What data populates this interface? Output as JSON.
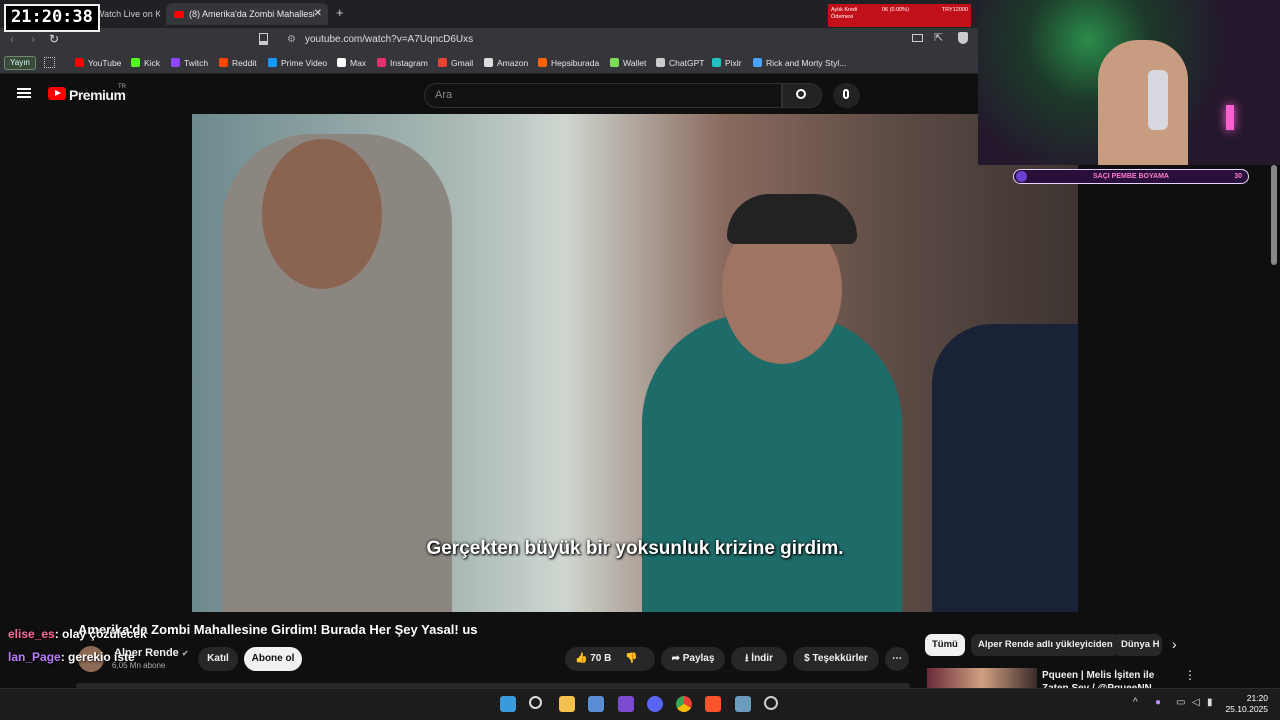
{
  "overlay": {
    "clock": "21:20:38",
    "widget_line1": "Aylık Kredi Ödemesi",
    "widget_line2": "06 (0.00%)",
    "widget_line3": "TRY12000",
    "progress_label": "SAÇI PEMBE BOYAMA",
    "progress_value": "30"
  },
  "tabs": [
    {
      "label": "Watch Live on Ki..."
    },
    {
      "label": "(8) Amerika'da Zombi Mahallesi"
    }
  ],
  "address": {
    "url": "youtube.com/watch?v=A7UqncD6Uxs"
  },
  "bookmarks": {
    "app_label": "Yayın",
    "items": [
      {
        "label": "YouTube",
        "color": "#ff0000"
      },
      {
        "label": "Kick",
        "color": "#53fc18"
      },
      {
        "label": "Twitch",
        "color": "#9146ff"
      },
      {
        "label": "Reddit",
        "color": "#ff4500"
      },
      {
        "label": "Prime Video",
        "color": "#1399ff"
      },
      {
        "label": "Max",
        "color": "#ffffff"
      },
      {
        "label": "Instagram",
        "color": "#e1306c"
      },
      {
        "label": "Gmail",
        "color": "#ea4335"
      },
      {
        "label": "Amazon",
        "color": "#dddddd"
      },
      {
        "label": "Hepsiburada",
        "color": "#ff6000"
      },
      {
        "label": "Wallet",
        "color": "#7ed957"
      },
      {
        "label": "ChatGPT",
        "color": "#cccccc"
      },
      {
        "label": "Pixlr",
        "color": "#22c1c3"
      },
      {
        "label": "Rick and Morty Styl...",
        "color": "#4aa3ff"
      }
    ]
  },
  "youtube": {
    "logo": "Premium",
    "region": "TR",
    "search_placeholder": "Ara",
    "subtitle": "Gerçekten büyük bir yoksunluk krizine girdim.",
    "title": "Amerika'da Zombi Mahallesine Girdim! Burada Her Şey Yasal! us",
    "channel": "Alper Rende",
    "subscribers": "6,05 Mn abone",
    "join_label": "Katıl",
    "subscribe_label": "Abone ol",
    "likes": "70 B",
    "share_label": "Paylaş",
    "download_label": "İndir",
    "thanks_label": "Teşekkürler",
    "chips": [
      "Tümü",
      "Alper Rende adlı yükleyiciden",
      "Dünya H"
    ],
    "rec_title": "Pqueen | Melis İşiten ile Zaten Şey / @PqueeNN"
  },
  "chat": [
    {
      "user": "elise_es",
      "user_color": "#ff6b9d",
      "text": ": olay çözülecek"
    },
    {
      "user": "lan_Page",
      "user_color": "#b97cff",
      "text": ": gerekio iste"
    }
  ],
  "system": {
    "time": "21:20",
    "date": "25.10.2025"
  }
}
